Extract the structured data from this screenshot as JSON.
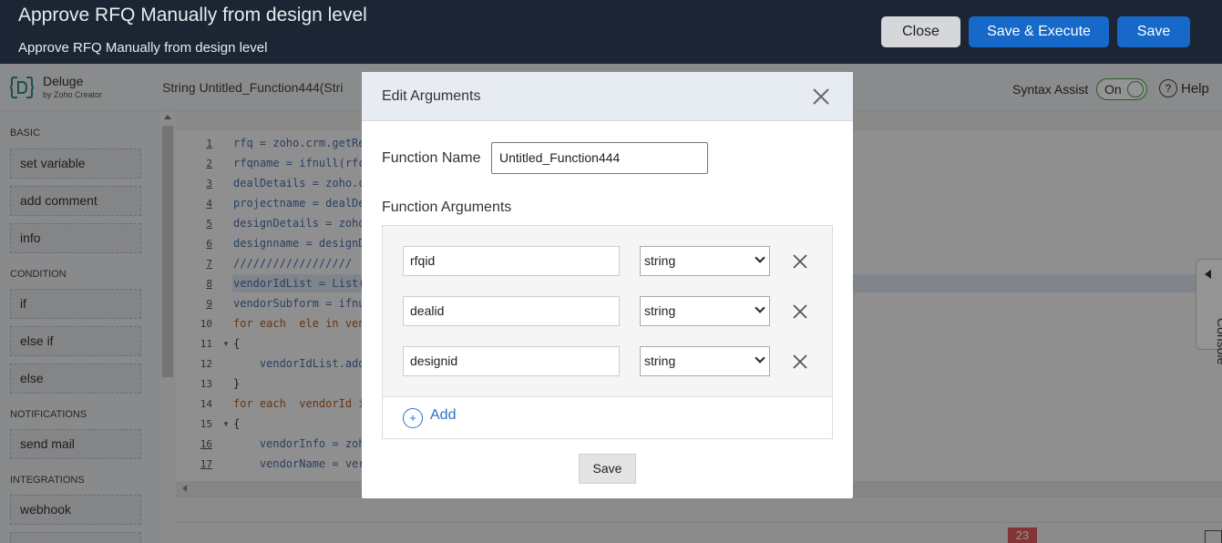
{
  "header": {
    "title": "Approve RFQ Manually from design level",
    "subtitle": "Approve RFQ Manually from design level",
    "close_label": "Close",
    "save_execute_label": "Save & Execute",
    "save_label": "Save"
  },
  "toolbar": {
    "product_name": "Deluge",
    "product_by": "by Zoho Creator",
    "function_signature": "String  Untitled_Function444(Stri",
    "syntax_assist_label": "Syntax Assist",
    "syntax_toggle_state": "On",
    "help_label": "Help"
  },
  "sidebar": {
    "sections": [
      {
        "title": "BASIC",
        "items": [
          "set variable",
          "add comment",
          "info"
        ]
      },
      {
        "title": "CONDITION",
        "items": [
          "if",
          "else if",
          "else"
        ]
      },
      {
        "title": "NOTIFICATIONS",
        "items": [
          "send mail"
        ]
      },
      {
        "title": "INTEGRATIONS",
        "items": [
          "webhook"
        ]
      }
    ]
  },
  "editor": {
    "lines": [
      {
        "num": "1",
        "text": "rfq = zoho.crm.getRe"
      },
      {
        "num": "2",
        "text": "rfqname = ifnull(rfc"
      },
      {
        "num": "3",
        "text": "dealDetails = zoho.c"
      },
      {
        "num": "4",
        "text": "projectname = dealDe"
      },
      {
        "num": "5",
        "text": "designDetails = zoho"
      },
      {
        "num": "6",
        "text": "designname = designD"
      },
      {
        "num": "7",
        "text": "//////////////////"
      },
      {
        "num": "8",
        "text": "vendorIdList = List("
      },
      {
        "num": "9",
        "text": "vendorSubform = ifnu"
      },
      {
        "num": "10",
        "text": "for each  ele in ven"
      },
      {
        "num": "11",
        "text": "{"
      },
      {
        "num": "12",
        "text": "    vendorIdList.add"
      },
      {
        "num": "13",
        "text": "}"
      },
      {
        "num": "14",
        "text": "for each  vendorId i"
      },
      {
        "num": "15",
        "text": "{"
      },
      {
        "num": "16",
        "text": "    vendorInfo = zoh"
      },
      {
        "num": "17",
        "text": "    vendorName = ver"
      }
    ],
    "error_count": "23",
    "console_label": "Console"
  },
  "modal": {
    "title": "Edit Arguments",
    "function_name_label": "Function Name",
    "function_name_value": "Untitled_Function444",
    "function_arguments_label": "Function Arguments",
    "arguments": [
      {
        "name": "rfqid",
        "type": "string"
      },
      {
        "name": "dealid",
        "type": "string"
      },
      {
        "name": "designid",
        "type": "string"
      }
    ],
    "add_icon": "+",
    "add_label": "Add",
    "save_label": "Save"
  }
}
